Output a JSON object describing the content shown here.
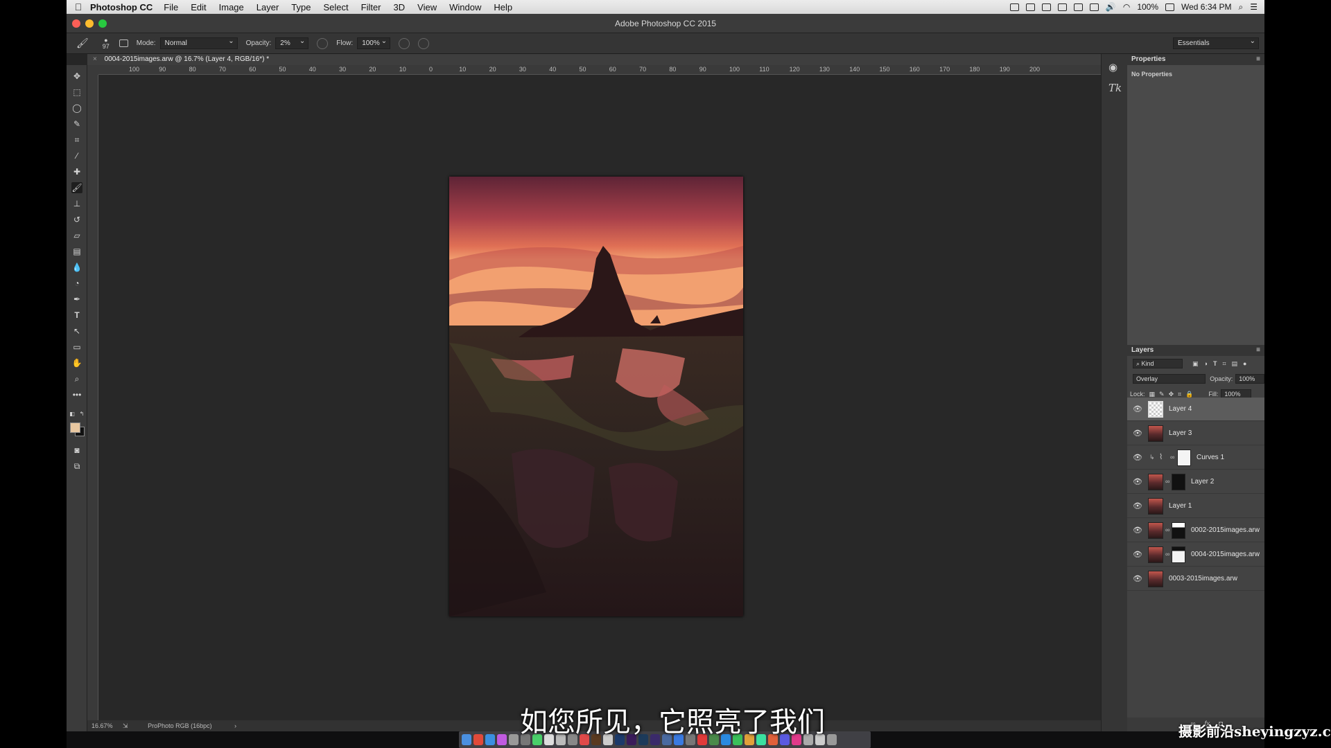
{
  "menubar": {
    "app_name": "Photoshop CC",
    "items": [
      "File",
      "Edit",
      "Image",
      "Layer",
      "Type",
      "Select",
      "Filter",
      "3D",
      "View",
      "Window",
      "Help"
    ],
    "battery": "100%",
    "clock": "Wed 6:34 PM"
  },
  "window": {
    "title": "Adobe Photoshop CC 2015"
  },
  "options": {
    "brush_size": "97",
    "mode_label": "Mode:",
    "mode_value": "Normal",
    "opacity_label": "Opacity:",
    "opacity_value": "2%",
    "flow_label": "Flow:",
    "flow_value": "100%",
    "workspace": "Essentials"
  },
  "document": {
    "tab_title": "0004-2015images.arw @ 16.7% (Layer 4, RGB/16*) *",
    "zoom": "16.67%",
    "profile": "ProPhoto RGB (16bpc)"
  },
  "ruler_ticks": [
    "100",
    "90",
    "80",
    "70",
    "60",
    "50",
    "40",
    "30",
    "20",
    "10",
    "0",
    "10",
    "20",
    "30",
    "40",
    "50",
    "60",
    "70",
    "80",
    "90",
    "100",
    "110",
    "120",
    "130",
    "140",
    "150",
    "160",
    "170",
    "180",
    "190",
    "200"
  ],
  "properties": {
    "title": "Properties",
    "body": "No Properties"
  },
  "layers_panel": {
    "title": "Layers",
    "filter_kind": "Kind",
    "blend_mode": "Overlay",
    "opacity_label": "Opacity:",
    "opacity_value": "100%",
    "lock_label": "Lock:",
    "fill_label": "Fill:",
    "fill_value": "100%",
    "layers": [
      {
        "name": "Layer 4",
        "selected": true
      },
      {
        "name": "Layer 3"
      },
      {
        "name": "Curves 1"
      },
      {
        "name": "Layer 2"
      },
      {
        "name": "Layer 1"
      },
      {
        "name": "0002-2015images.arw"
      },
      {
        "name": "0004-2015images.arw"
      },
      {
        "name": "0003-2015images.arw"
      }
    ]
  },
  "overlay": {
    "subtitle": "如您所见，它照亮了我们",
    "watermark": "摄影前沿sheyingzyz.com"
  },
  "colors": {
    "foreground": "#e8c7a0",
    "background": "#111111"
  }
}
